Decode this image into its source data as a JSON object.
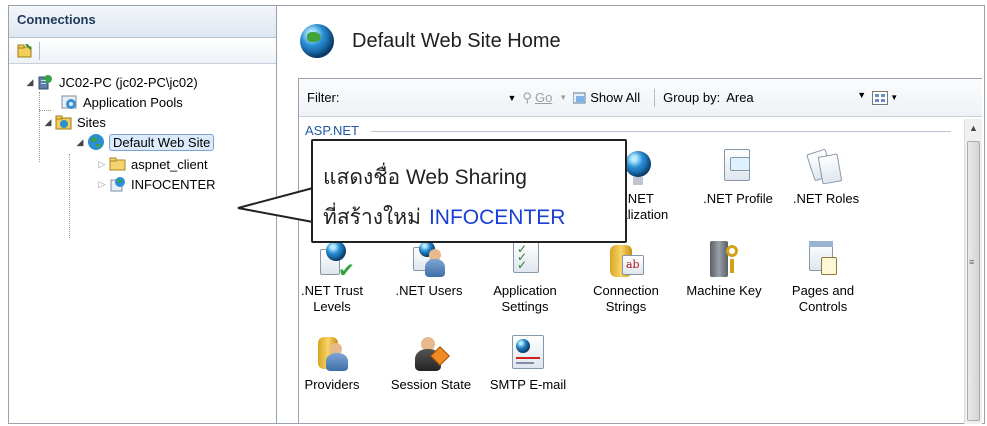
{
  "connections": {
    "title": "Connections",
    "tree": [
      {
        "id": "server",
        "label": "JC02-PC (jc02-PC\\jc02)",
        "icon": "server-icon"
      },
      {
        "id": "app-pools",
        "label": "Application Pools",
        "icon": "application-pools-icon"
      },
      {
        "id": "sites",
        "label": "Sites",
        "icon": "sites-folder-icon"
      },
      {
        "id": "default-web-site",
        "label": "Default Web Site",
        "icon": "website-globe-icon"
      },
      {
        "id": "aspnet-client",
        "label": "aspnet_client",
        "icon": "folder-icon"
      },
      {
        "id": "infocenter",
        "label": "INFOCENTER",
        "icon": "application-icon"
      }
    ]
  },
  "main": {
    "title": "Default Web Site Home",
    "filter": {
      "label": "Filter:",
      "value": "",
      "go": "Go",
      "show_all": "Show All",
      "group_by_label": "Group by:",
      "group_by_value": "Area"
    },
    "section": "ASP.NET",
    "features": [
      {
        "label": ".NET",
        "label2": "...alization",
        "icon": "net-globalization-icon"
      },
      {
        "label": ".NET Profile",
        "icon": "net-profile-icon"
      },
      {
        "label": ".NET Roles",
        "icon": "net-roles-icon"
      },
      {
        "label": ".NET Trust",
        "label2": "Levels",
        "icon": "net-trust-levels-icon"
      },
      {
        "label": ".NET Users",
        "icon": "net-users-icon"
      },
      {
        "label": "Application",
        "label2": "Settings",
        "icon": "application-settings-icon"
      },
      {
        "label": "Connection",
        "label2": "Strings",
        "icon": "connection-strings-icon"
      },
      {
        "label": "Machine Key",
        "icon": "machine-key-icon"
      },
      {
        "label": "Pages and",
        "label2": "Controls",
        "icon": "pages-controls-icon"
      },
      {
        "label": "Providers",
        "icon": "providers-icon"
      },
      {
        "label": "Session State",
        "icon": "session-state-icon"
      },
      {
        "label": "SMTP E-mail",
        "icon": "smtp-email-icon"
      }
    ]
  },
  "callout": {
    "line1": "แสดงชื่อ Web Sharing",
    "line2_prefix": "ที่สร้างใหม่",
    "line2_highlight": "INFOCENTER",
    "highlight_color": "#1a3fd6"
  }
}
